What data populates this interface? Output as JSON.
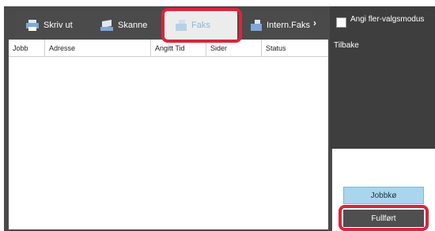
{
  "tabs": [
    {
      "label": "Skriv ut",
      "icon": "printer-icon"
    },
    {
      "label": "Skanne",
      "icon": "scanner-icon"
    },
    {
      "label": "Faks",
      "icon": "fax-icon"
    },
    {
      "label": "Intern.Faks",
      "icon": "internet-fax-icon"
    }
  ],
  "nav": {
    "expand_icon": "chevron-right-icon",
    "expand_glyph": "›"
  },
  "table": {
    "columns": [
      "Jobb",
      "Adresse",
      "Angitt Tid",
      "Sider",
      "Status"
    ]
  },
  "panel": {
    "multi_select_label": "Angi fler-valgsmodus",
    "back_label": "Tilbake"
  },
  "buttons": {
    "job_queue": "Jobbkø",
    "completed": "Fullført"
  },
  "colors": {
    "highlight": "#d7263d",
    "active_tab_text": "#8ab7df",
    "queue_button": "#a9d6ec"
  }
}
